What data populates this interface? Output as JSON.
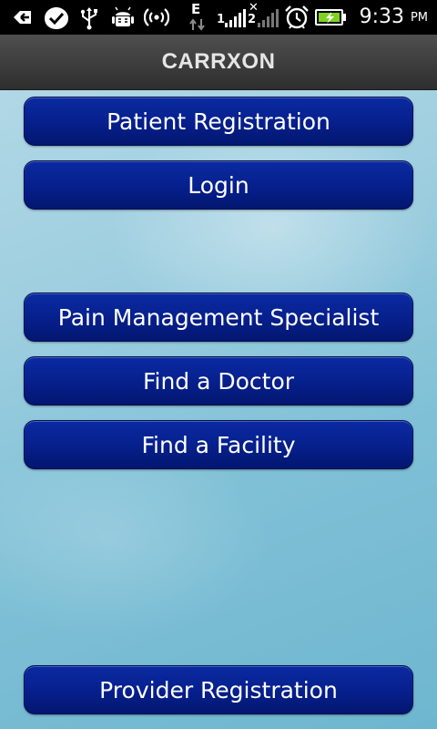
{
  "status_bar": {
    "icons": [
      "back-arrow-icon",
      "checkmark-badge-icon",
      "usb-icon",
      "android-debug-icon",
      "wifi-hotspot-icon",
      "data-edge-icon",
      "signal-strength-icon",
      "signal-roaming-icon",
      "alarm-clock-icon",
      "battery-charging-icon"
    ],
    "time": "9:33",
    "ampm": "PM",
    "network_type": "E",
    "signal_label_1": "1",
    "signal_label_2": "2"
  },
  "app": {
    "title": "CARRXON"
  },
  "menu": {
    "patient_registration": "Patient Registration",
    "login": "Login",
    "pain_management_specialist": "Pain Management Specialist",
    "find_a_doctor": "Find a Doctor",
    "find_a_facility": "Find a Facility",
    "provider_registration": "Provider Registration"
  },
  "colors": {
    "button_blue": "#06208e",
    "title_bar": "#3c3c3c",
    "background": "#9fcfe0",
    "battery_green": "#7ed321"
  }
}
